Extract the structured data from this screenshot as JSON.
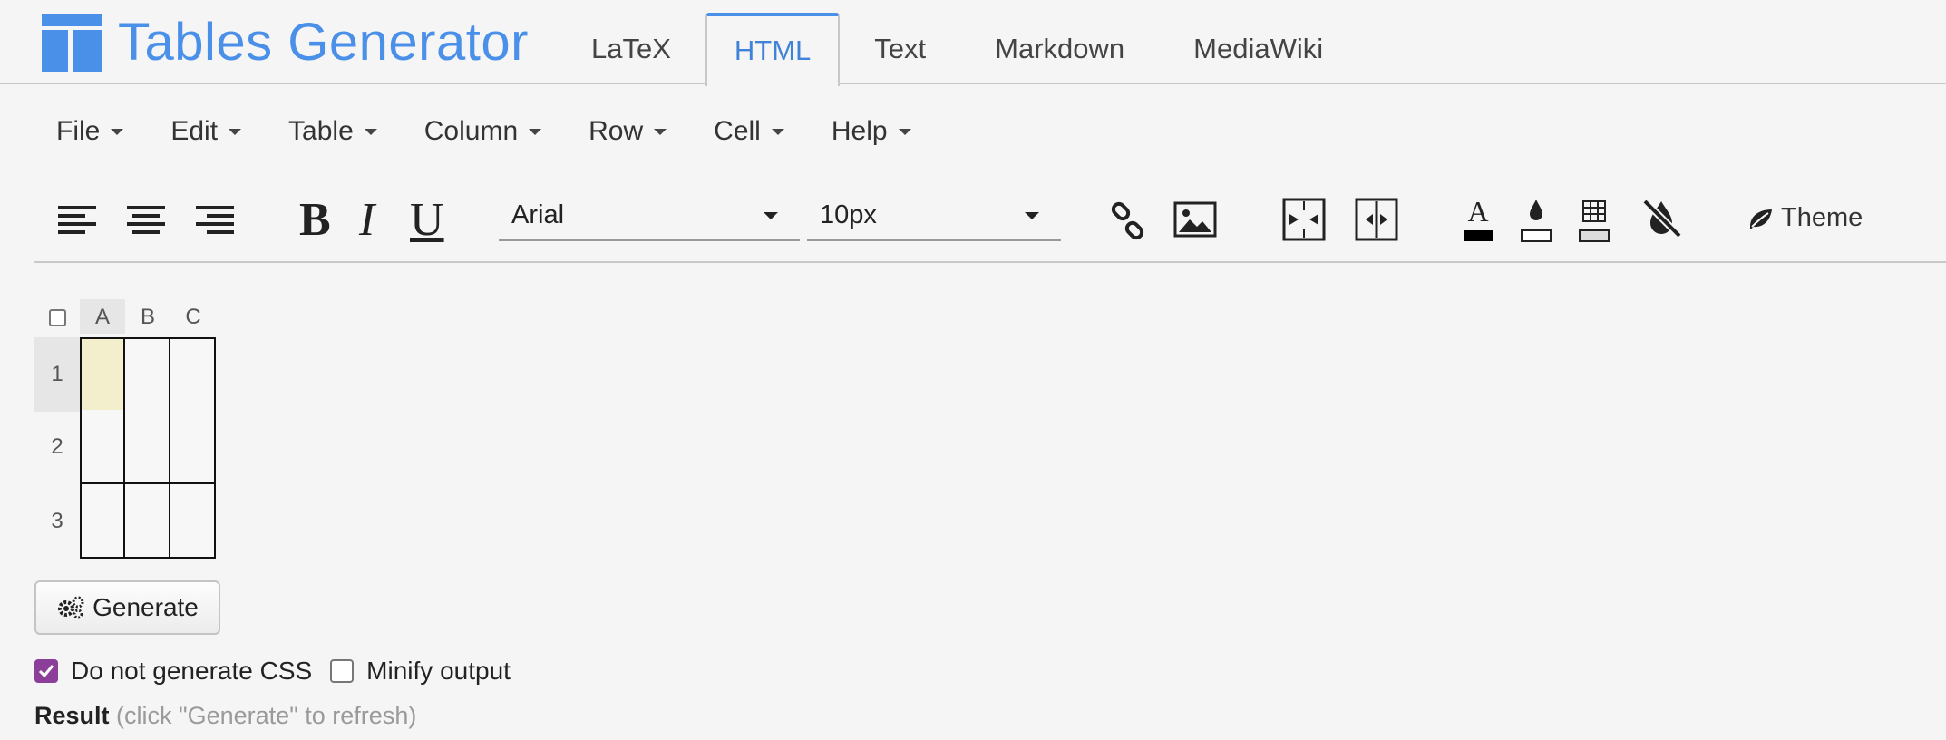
{
  "app": {
    "title": "Tables Generator",
    "brand_color": "#4a8fe8"
  },
  "tabs": [
    {
      "label": "LaTeX",
      "active": false
    },
    {
      "label": "HTML",
      "active": true
    },
    {
      "label": "Text",
      "active": false
    },
    {
      "label": "Markdown",
      "active": false
    },
    {
      "label": "MediaWiki",
      "active": false
    }
  ],
  "menu": [
    {
      "label": "File"
    },
    {
      "label": "Edit"
    },
    {
      "label": "Table"
    },
    {
      "label": "Column"
    },
    {
      "label": "Row"
    },
    {
      "label": "Cell"
    },
    {
      "label": "Help"
    }
  ],
  "toolbar": {
    "align_icons": [
      "align-left-icon",
      "align-center-icon",
      "align-right-icon"
    ],
    "format": {
      "bold": "B",
      "italic": "I",
      "underline": "U"
    },
    "font_family": "Arial",
    "font_size": "10px",
    "icons": [
      "link-icon",
      "image-icon",
      "merge-cells-icon",
      "split-cells-icon",
      "text-color-icon",
      "background-color-icon",
      "border-color-icon",
      "clear-format-icon"
    ],
    "theme_label": "Theme"
  },
  "grid": {
    "columns": [
      "A",
      "B",
      "C"
    ],
    "rows": [
      "1",
      "2",
      "3"
    ],
    "selected_cell": "A1",
    "highlight_color": "#f3efcc"
  },
  "actions": {
    "generate_label": "Generate"
  },
  "options": {
    "no_css_label": "Do not generate CSS",
    "no_css_checked": true,
    "minify_label": "Minify output",
    "minify_checked": false
  },
  "result": {
    "label": "Result",
    "hint": "(click \"Generate\" to refresh)"
  }
}
